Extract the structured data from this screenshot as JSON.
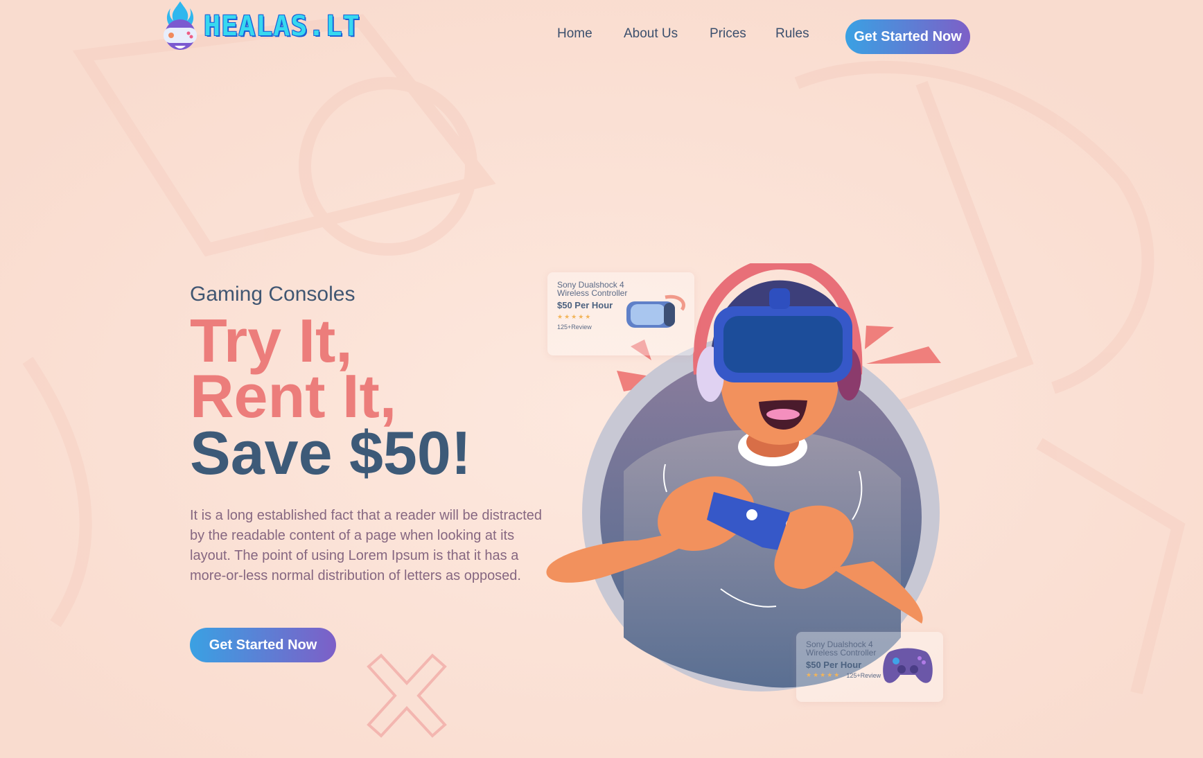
{
  "logo": {
    "text": "HEALAS.LT"
  },
  "nav": {
    "items": [
      {
        "label": "Home"
      },
      {
        "label": "About Us"
      },
      {
        "label": "Prices"
      },
      {
        "label": "Rules"
      }
    ],
    "cta_label": "Get Started Now"
  },
  "hero": {
    "subtitle": "Gaming Consoles",
    "headline_line1": "Try It,",
    "headline_line2": "Rent It,",
    "headline_line3": "Save $50!",
    "description": "It is a long established fact that a reader will be distracted by the readable content of a page when looking at its layout. The point of using Lorem Ipsum is that it has a more-or-less normal distribution of letters as opposed.",
    "cta_label": "Get Started Now"
  },
  "product_cards": [
    {
      "title": "Sony Dualshock 4 Wireless Controller",
      "price": "$50 Per Hour",
      "rating": 5,
      "stars": "★★★★★",
      "reviews": "125+Review",
      "icon": "vr-headset-icon"
    },
    {
      "title": "Sony Dualshock 4 Wireless Controller",
      "price": "$50 Per Hour",
      "rating": 5,
      "stars": "★★★★★",
      "reviews": "125+Review",
      "icon": "gamepad-icon"
    }
  ],
  "colors": {
    "background": "#fbe2d6",
    "headline_accent": "#ec7d7b",
    "headline_dark": "#3d5a78",
    "button_gradient_start": "#3aa1e3",
    "button_gradient_end": "#7d5fc7",
    "logo_cyan": "#37d8f0"
  }
}
